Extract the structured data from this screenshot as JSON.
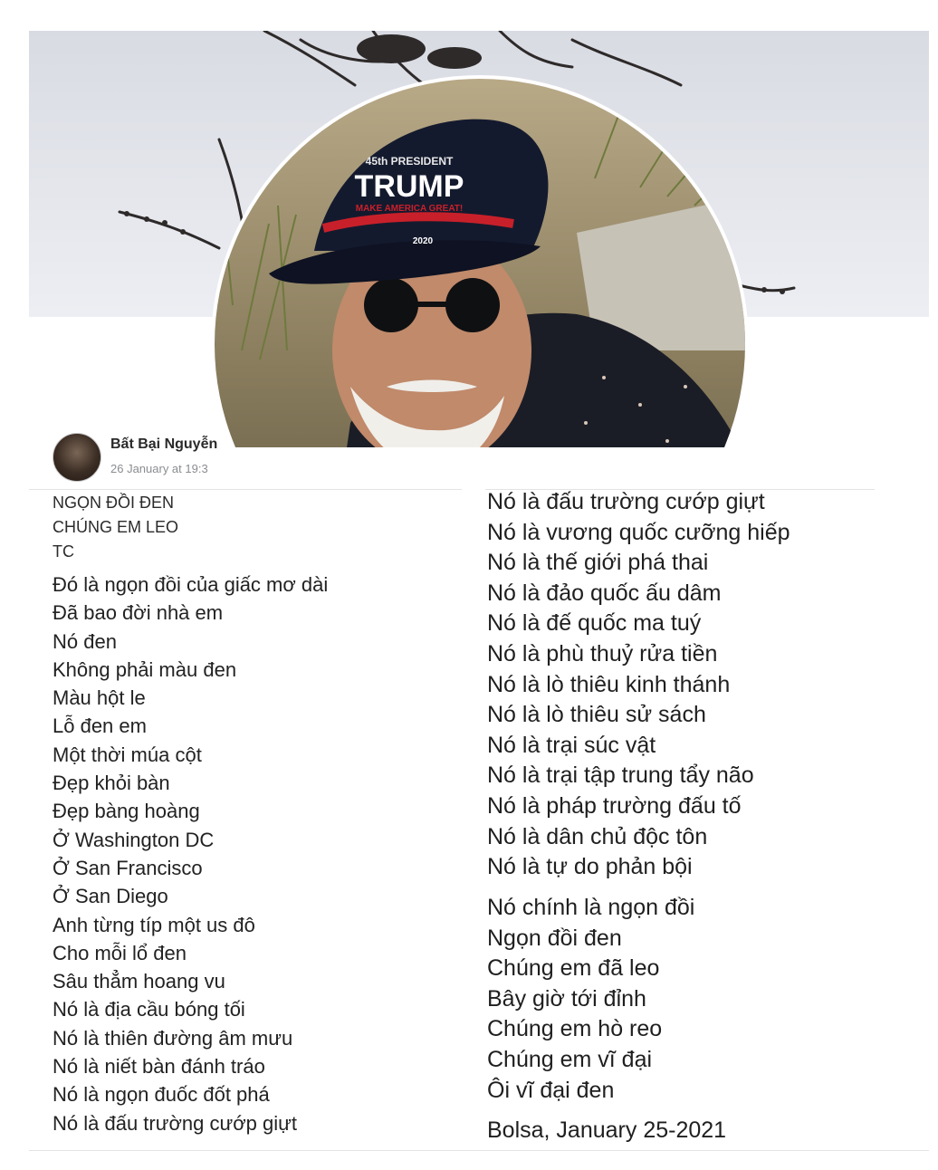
{
  "post": {
    "author": "Bất Bại Nguyễn",
    "timestamp": "26 January at 19:3"
  },
  "poem": {
    "header_lines": [
      "NGỌN ĐỒI ĐEN",
      "CHÚNG EM LEO",
      "TC"
    ],
    "left_lines": [
      "Đó là ngọn đồi của giấc mơ dài",
      "Đã bao đời nhà em",
      "Nó đen",
      "Không phải màu đen",
      "Màu hột le",
      "Lỗ đen em",
      "Một thời múa cột",
      "Đẹp khỏi bàn",
      "Đẹp bàng hoàng",
      "Ở Washington DC",
      "Ở San Francisco",
      "Ở San Diego",
      "Anh từng típ một us đô",
      "Cho mỗi lổ đen",
      "Sâu thẳm hoang vu",
      "Nó là địa cầu bóng tối",
      "Nó là thiên đường âm mưu",
      "Nó là niết bàn đánh tráo",
      "Nó là ngọn đuốc đốt phá",
      "Nó là đấu trường cướp giựt"
    ],
    "right_lines_a": [
      "Nó là đấu trường cướp giựt",
      "Nó là vương quốc cưỡng hiếp",
      "Nó là thế giới phá thai",
      "Nó là đảo quốc ấu dâm",
      "Nó là đế quốc ma tuý",
      "Nó là phù thuỷ rửa tiền",
      "Nó là lò thiêu kinh thánh",
      "Nó là lò thiêu sử sách",
      "Nó là trại súc vật",
      "Nó là trại tập trung tẩy não",
      "Nó là pháp trường đấu tố",
      "Nó là dân chủ độc tôn",
      "Nó là tự do phản bội"
    ],
    "right_lines_b": [
      "Nó chính là ngọn đồi",
      "Ngọn đồi đen",
      "Chúng em đã leo",
      "Bây giờ tới đỉnh",
      "Chúng em hò reo",
      "Chúng em vĩ đại",
      "Ôi vĩ đại đen"
    ],
    "signature": "Bolsa, January 25-2021"
  },
  "profile_photo": {
    "cap_text_top": "45th PRESIDENT",
    "cap_text_main": "TRUMP",
    "cap_text_sub": "MAKE AMERICA GREAT!",
    "cap_year": "2020"
  },
  "colors": {
    "cover_sky": "#e4e6ec",
    "text": "#1f1f1f",
    "timestamp": "#8a8d91",
    "cap_red": "#c8202a",
    "cap_navy": "#141a2e"
  }
}
